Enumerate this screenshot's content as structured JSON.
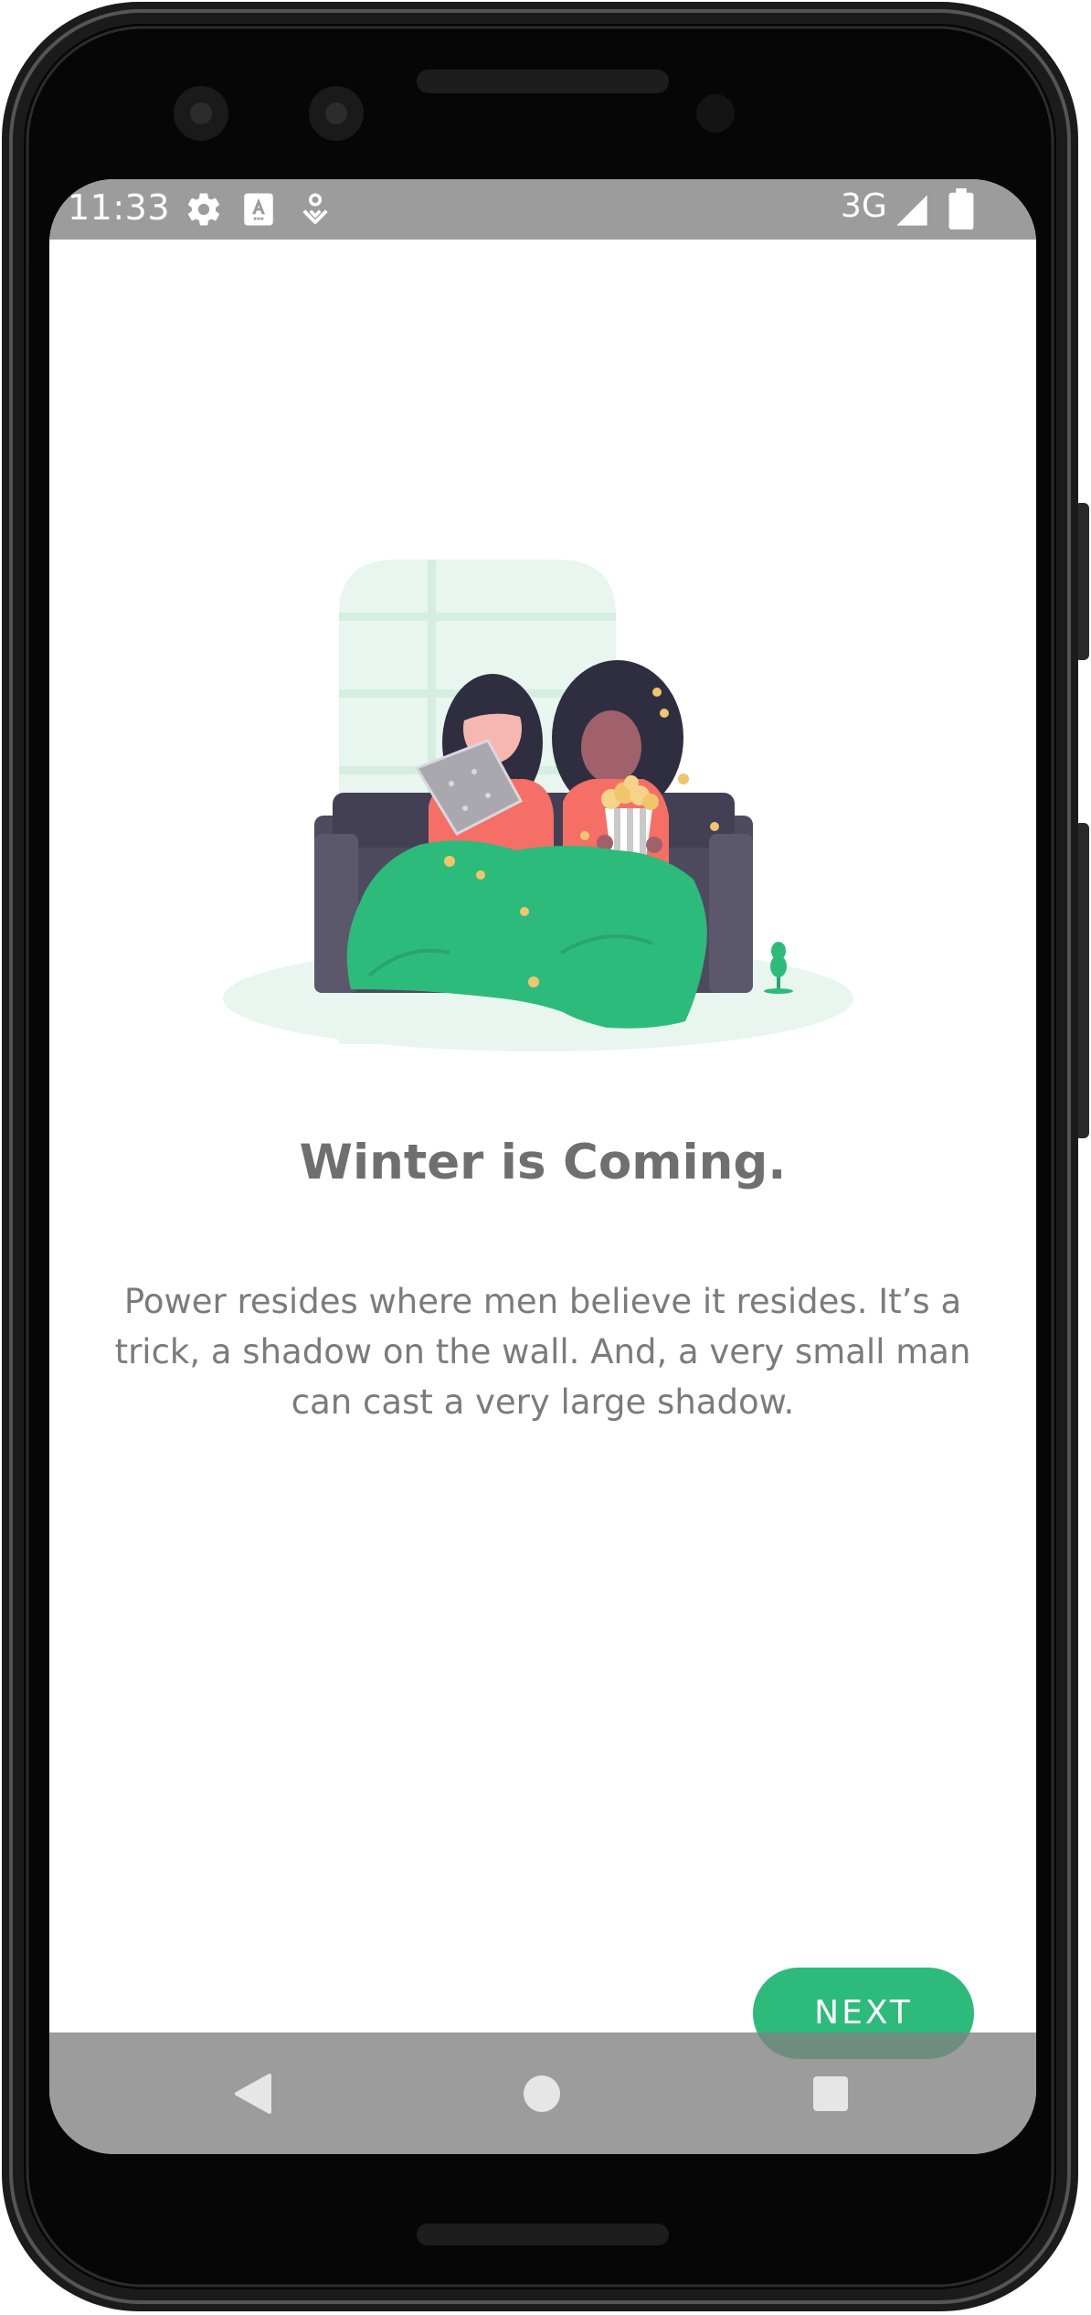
{
  "status_bar": {
    "time": "11:33",
    "network": "3G",
    "icons": [
      "settings-icon",
      "accessibility-a-icon",
      "location-pin-icon",
      "signal-icon",
      "battery-icon"
    ]
  },
  "onboarding": {
    "title": "Winter is Coming.",
    "body": "Power resides where men believe it resides. It’s a trick, a shadow on the wall. And, a very small man can cast a very large shadow.",
    "next_label": "NEXT"
  },
  "nav_bar": {
    "icons": [
      "back-icon",
      "home-icon",
      "recents-icon"
    ]
  },
  "colors": {
    "accent": "#2dbb7b",
    "text_title": "#6f6f6f",
    "text_body": "#7b7b7b",
    "status_bar": "#9c9c9c"
  }
}
